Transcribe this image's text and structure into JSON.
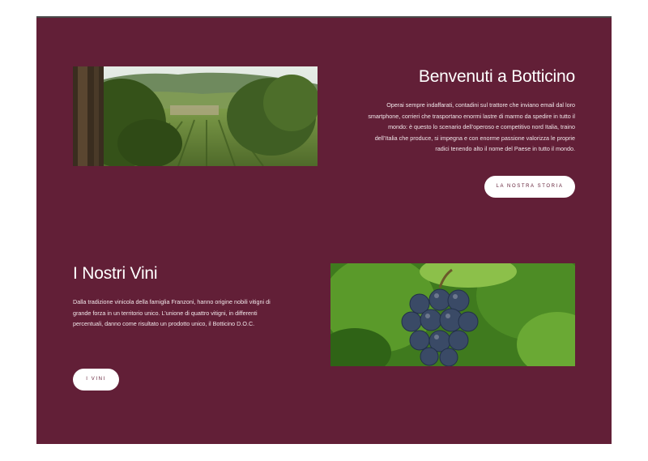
{
  "intro": {
    "title": "Benvenuti a Botticino",
    "paragraph": "Operai sempre indaffarati, contadini sul trattore che inviano email dal loro smartphone, corrieri che trasportano enormi lastre di marmo da spedire in tutto il mondo: è questo lo scenario dell’operoso e competitivo nord Italia, traino dell’Italia che produce, si impegna e con enorme passione valorizza le proprie radici tenendo alto il nome del Paese in tutto il mondo.",
    "button_label": "LA NOSTRA STORIA"
  },
  "wines": {
    "title": "I Nostri Vini",
    "paragraph": "Dalla tradizione vinicola della famiglia Franzoni, hanno origine nobili vitigni di grande forza in un territorio unico. L’unione di quattro vitigni, in differenti percentuali, danno come risultato un prodotto unico, il Botticino D.O.C.",
    "button_label": "I VINI"
  },
  "colors": {
    "background": "#621f37",
    "button_bg": "#ffffff",
    "button_text": "#621f37"
  }
}
